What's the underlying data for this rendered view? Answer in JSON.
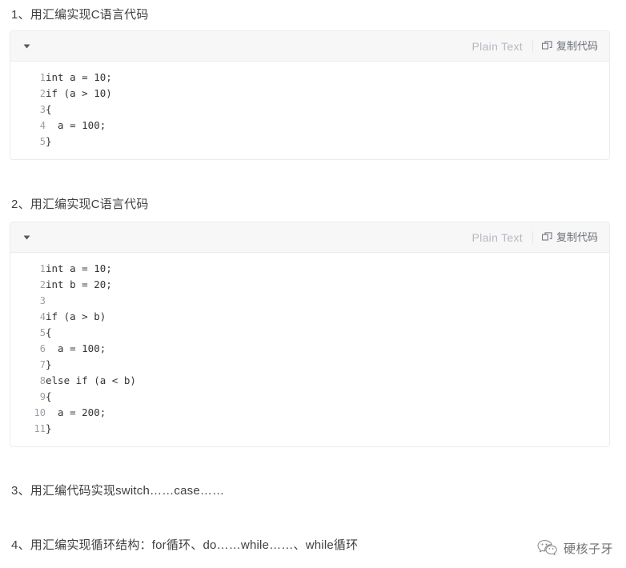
{
  "headings": [
    {
      "id": "h1",
      "text": "1、用汇编实现C语言代码"
    },
    {
      "id": "h2",
      "text": "2、用汇编实现C语言代码"
    },
    {
      "id": "h3",
      "text": "3、用汇编代码实现switch……case……"
    },
    {
      "id": "h4",
      "text": "4、用汇编实现循环结构：for循环、do……while……、while循环"
    }
  ],
  "code_blocks": [
    {
      "language_label": "Plain Text",
      "copy_label": "复制代码",
      "collapse_icon": "caret-down-icon",
      "copy_icon": "copy-icon",
      "lines": [
        {
          "n": "1",
          "text": "int a = 10;"
        },
        {
          "n": "2",
          "text": "if (a > 10)"
        },
        {
          "n": "3",
          "text": "{"
        },
        {
          "n": "4",
          "text": "  a = 100;"
        },
        {
          "n": "5",
          "text": "}"
        }
      ]
    },
    {
      "language_label": "Plain Text",
      "copy_label": "复制代码",
      "collapse_icon": "caret-down-icon",
      "copy_icon": "copy-icon",
      "lines": [
        {
          "n": "1",
          "text": "int a = 10;"
        },
        {
          "n": "2",
          "text": "int b = 20;"
        },
        {
          "n": "3",
          "text": ""
        },
        {
          "n": "4",
          "text": "if (a > b)"
        },
        {
          "n": "5",
          "text": "{"
        },
        {
          "n": "6",
          "text": "  a = 100;"
        },
        {
          "n": "7",
          "text": "}"
        },
        {
          "n": "8",
          "text": "else if (a < b)"
        },
        {
          "n": "9",
          "text": "{"
        },
        {
          "n": "10",
          "text": "  a = 200;"
        },
        {
          "n": "11",
          "text": "}"
        }
      ]
    }
  ],
  "watermark": {
    "icon": "wechat-icon",
    "text": "硬核子牙"
  },
  "colors": {
    "page_background": "#ffffff",
    "card_border": "#eaecef",
    "header_background": "#f7f7f8",
    "heading_text": "#3f3f3f",
    "code_text": "#333333",
    "line_number_text": "#9aa0a6",
    "language_label_text": "#b5b9c0",
    "copy_label_text": "#6b6f76"
  }
}
